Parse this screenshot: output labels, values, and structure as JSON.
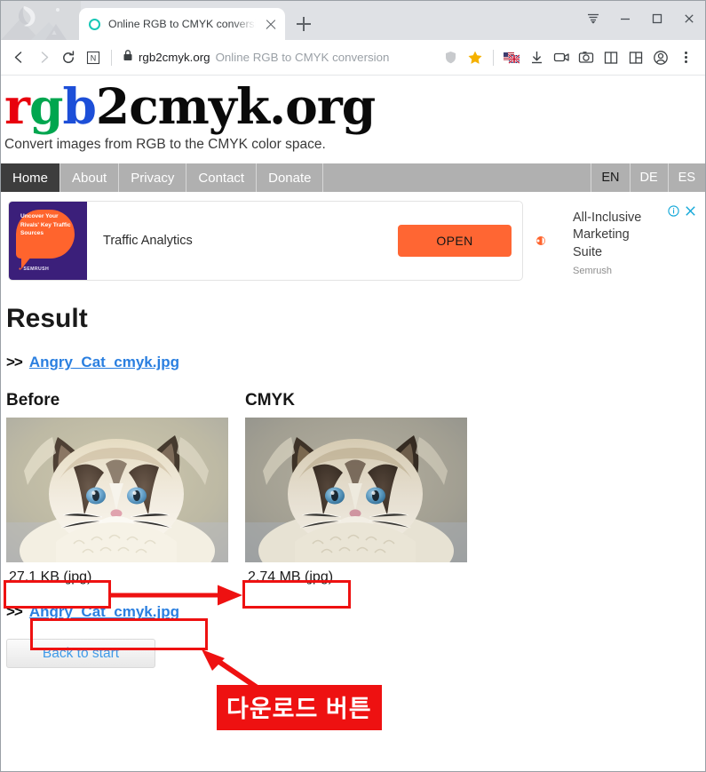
{
  "browser": {
    "tab": {
      "title": "Online RGB to CMYK conversion",
      "favicon": "circle-teal-icon",
      "close": "×"
    },
    "newtab_label": "+",
    "window_controls": {
      "menu": "hamburger-caret-icon",
      "minimize": "—",
      "maximize": "□",
      "close": "×"
    },
    "toolbar": {
      "back": "back-arrow-icon",
      "forward": "forward-arrow-icon",
      "reload": "reload-icon",
      "whale": "N",
      "lock": "lock-icon",
      "url_domain": "rgb2cmyk.org",
      "url_rest": "Online RGB to CMYK conversion",
      "shield": "shield-icon",
      "bookmark": "star-icon",
      "translate": "flag-icon",
      "download": "download-icon",
      "videocam": "video-camera-icon",
      "capture": "camera-icon",
      "sidebar": "sidebar-icon",
      "splitview": "split-view-icon",
      "profile": "profile-icon",
      "menu": "three-dots-menu-icon"
    }
  },
  "site": {
    "logo": {
      "part_rgb": "rgb",
      "part_two": "2",
      "part_cmyk": "cmyk.org"
    },
    "tagline": "Convert images from RGB to the CMYK color space.",
    "nav": [
      {
        "label": "Home",
        "active": true
      },
      {
        "label": "About",
        "active": false
      },
      {
        "label": "Privacy",
        "active": false
      },
      {
        "label": "Contact",
        "active": false
      },
      {
        "label": "Donate",
        "active": false
      }
    ],
    "languages": [
      {
        "label": "EN",
        "current": true
      },
      {
        "label": "DE",
        "current": false
      },
      {
        "label": "ES",
        "current": false
      }
    ]
  },
  "ad": {
    "tile_text": "Uncover Your Rivals' Key Traffic Sources",
    "tile_brand": "SEMRUSH",
    "title": "Traffic Analytics",
    "cta": "OPEN",
    "right_title": "All-Inclusive Marketing Suite",
    "right_brand": "Semrush",
    "info_icon": "info-icon",
    "close_icon": "close-icon"
  },
  "result": {
    "heading": "Result",
    "top_link": {
      "prefix": ">>",
      "filename": "Angry_Cat_cmyk.jpg"
    },
    "before": {
      "heading": "Before",
      "size": "27.1 KB (jpg)"
    },
    "cmyk": {
      "heading": "CMYK",
      "size": "2.74 MB (jpg)"
    },
    "bottom_link": {
      "prefix": ">>",
      "filename": "Angry_Cat_cmyk.jpg"
    },
    "back_button": "Back to start"
  },
  "annotations": {
    "callout_text": "다운로드 버튼",
    "color": "#ee1111"
  }
}
